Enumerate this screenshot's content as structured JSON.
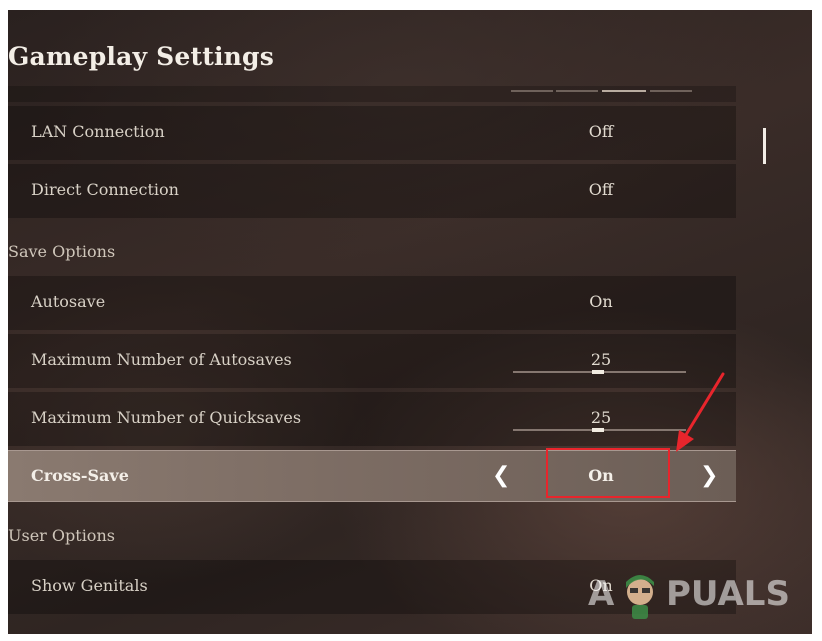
{
  "title": "Gameplay Settings",
  "rows": [
    {
      "label": "LAN Connection",
      "value": "Off"
    },
    {
      "label": "Direct Connection",
      "value": "Off"
    },
    {
      "label": "Autosave",
      "value": "On"
    },
    {
      "label": "Maximum Number of Autosaves",
      "value": "25",
      "slider_fraction": 0.49
    },
    {
      "label": "Maximum Number of Quicksaves",
      "value": "25",
      "slider_fraction": 0.49
    },
    {
      "label": "Cross-Save",
      "value": "On",
      "selected": true
    },
    {
      "label": "Show Genitals",
      "value": "On"
    }
  ],
  "sections": {
    "save_options": "Save Options",
    "user_options": "User Options"
  },
  "arrows": {
    "left_icon": "chevron-left-icon",
    "right_icon": "chevron-right-icon"
  },
  "watermark": {
    "first": "A",
    "rest": "PUALS"
  },
  "colors": {
    "annotation_red": "#e8252c",
    "selected_row": "#8a7a70"
  }
}
